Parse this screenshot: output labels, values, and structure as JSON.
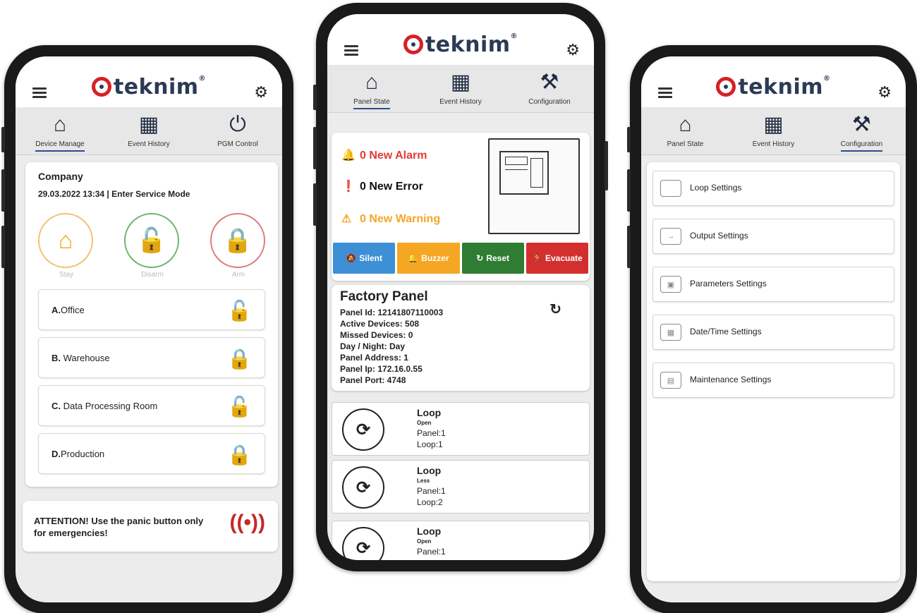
{
  "brand": {
    "name": "teknim",
    "reg": "®"
  },
  "phone1": {
    "tabs": [
      {
        "label": "Device Manage",
        "icon": "home-icon",
        "active": true
      },
      {
        "label": "Event History",
        "icon": "calendar-icon",
        "active": false
      },
      {
        "label": "PGM Control",
        "icon": "power-icon",
        "active": false
      }
    ],
    "company": "Company",
    "status": "29.03.2022 13:34 | Enter Service Mode",
    "modes": [
      {
        "label": "Stay",
        "icon": "home-icon",
        "color": "#f5a623"
      },
      {
        "label": "Disarm",
        "icon": "unlock-icon",
        "color": "#2e7d32"
      },
      {
        "label": "Arm",
        "icon": "lock-icon",
        "color": "#c62828"
      }
    ],
    "zones": [
      {
        "letter": "A.",
        "name": "Office",
        "state": "unlock-icon",
        "color": "#2e7d32"
      },
      {
        "letter": "B.",
        "name": "Warehouse",
        "state": "lock-icon",
        "color": "#c62828"
      },
      {
        "letter": "C.",
        "name": "Data Processing Room",
        "state": "unlock-icon",
        "color": "#2e7d32"
      },
      {
        "letter": "D.",
        "name": "Production",
        "state": "lock-icon",
        "color": "#c62828"
      }
    ],
    "panic_text": "ATTENTION! Use the panic button only for emergencies!"
  },
  "phone2": {
    "tabs": [
      {
        "label": "Panel State",
        "icon": "home-icon",
        "active": true
      },
      {
        "label": "Event History",
        "icon": "calendar-icon",
        "active": false
      },
      {
        "label": "Configuration",
        "icon": "wrench-gear-icon",
        "active": false
      }
    ],
    "alarm": "0 New Alarm",
    "error": "0 New Error",
    "warning": "0 New Warning",
    "actions": [
      {
        "label": "Silent",
        "color": "#3d8fd6"
      },
      {
        "label": "Buzzer",
        "color": "#f5a623"
      },
      {
        "label": "Reset",
        "color": "#2e7d32"
      },
      {
        "label": "Evacuate",
        "color": "#d32f2f"
      }
    ],
    "panel_title": "Factory Panel",
    "panel_lines": [
      "Panel Id: 12141807110003",
      "Active Devices: 508",
      "Missed Devices: 0",
      "Day / Night: Day",
      "Panel Address: 1",
      "Panel Ip: 172.16.0.55",
      "Panel Port: 4748"
    ],
    "loops": [
      {
        "title": "Loop",
        "state": "Open",
        "panel": "Panel:1",
        "loop": "Loop:1"
      },
      {
        "title": "Loop",
        "state": "Less",
        "panel": "Panel:1",
        "loop": "Loop:2"
      },
      {
        "title": "Loop",
        "state": "Open",
        "panel": "Panel:1",
        "loop": ""
      }
    ]
  },
  "phone3": {
    "tabs": [
      {
        "label": "Panel State",
        "icon": "home-icon",
        "active": false
      },
      {
        "label": "Event History",
        "icon": "calendar-icon",
        "active": false
      },
      {
        "label": "Configuration",
        "icon": "wrench-gear-icon",
        "active": true
      }
    ],
    "settings": [
      {
        "label": "Loop Settings",
        "icon": "loop-icon"
      },
      {
        "label": "Output Settings",
        "icon": "output-icon"
      },
      {
        "label": "Parameters Settings",
        "icon": "parameters-icon"
      },
      {
        "label": "Date/Time Settings",
        "icon": "calendar-clock-icon"
      },
      {
        "label": "Maintenance Settings",
        "icon": "maintenance-icon"
      }
    ]
  }
}
